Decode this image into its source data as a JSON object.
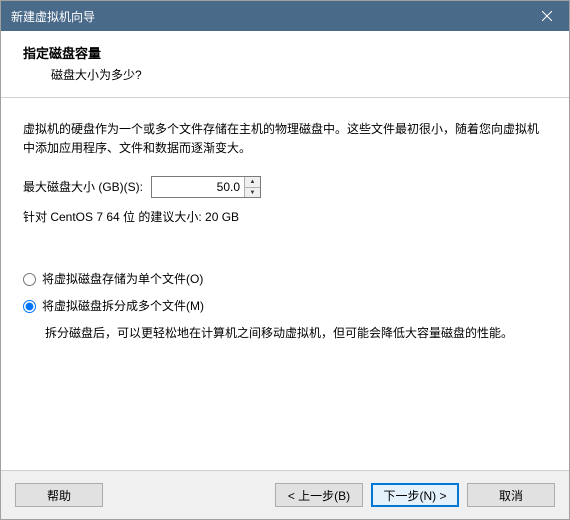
{
  "window": {
    "title": "新建虚拟机向导"
  },
  "header": {
    "title": "指定磁盘容量",
    "subtitle": "磁盘大小为多少?"
  },
  "content": {
    "description": "虚拟机的硬盘作为一个或多个文件存储在主机的物理磁盘中。这些文件最初很小，随着您向虚拟机中添加应用程序、文件和数据而逐渐变大。",
    "size_label": "最大磁盘大小 (GB)(S):",
    "size_value": "50.0",
    "recommend": "针对 CentOS 7 64 位 的建议大小: 20 GB",
    "radio_single": "将虚拟磁盘存储为单个文件(O)",
    "radio_split": "将虚拟磁盘拆分成多个文件(M)",
    "split_desc": "拆分磁盘后，可以更轻松地在计算机之间移动虚拟机，但可能会降低大容量磁盘的性能。"
  },
  "footer": {
    "help": "帮助",
    "back": "< 上一步(B)",
    "next": "下一步(N) >",
    "cancel": "取消"
  }
}
